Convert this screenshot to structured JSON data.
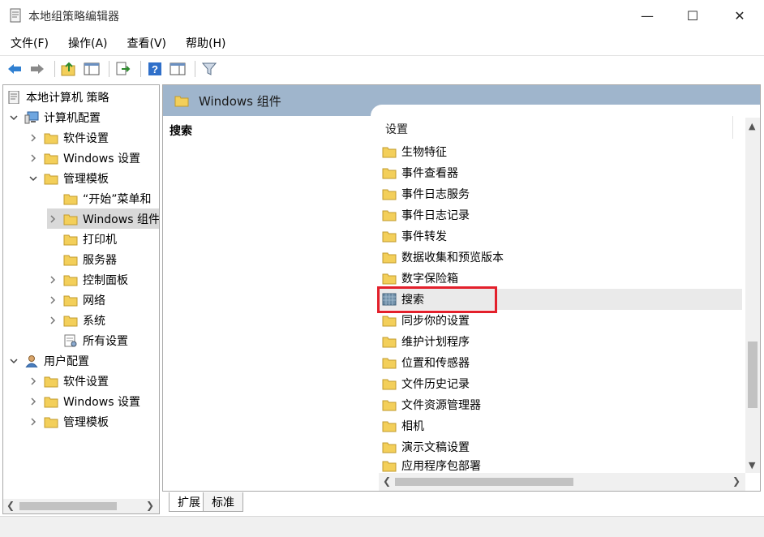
{
  "window": {
    "title": "本地组策略编辑器",
    "controls": {
      "minimize": "—",
      "maximize": "☐",
      "close": "✕"
    }
  },
  "menu": [
    {
      "label": "文件(F)"
    },
    {
      "label": "操作(A)"
    },
    {
      "label": "查看(V)"
    },
    {
      "label": "帮助(H)"
    }
  ],
  "toolbar": [
    {
      "icon": "back-arrow-icon"
    },
    {
      "icon": "forward-arrow-icon"
    },
    {
      "icon": "up-folder-icon"
    },
    {
      "icon": "show-hide-tree-icon"
    },
    {
      "icon": "export-list-icon"
    },
    {
      "icon": "help-icon"
    },
    {
      "icon": "properties-pane-icon"
    },
    {
      "icon": "filter-icon"
    }
  ],
  "tree": {
    "root": "本地计算机 策略",
    "computer_config": "计算机配置",
    "cc_software": "软件设置",
    "cc_windows": "Windows 设置",
    "cc_admin": "管理模板",
    "start_menu": "“开始”菜单和",
    "windows_components": "Windows 组件",
    "printers": "打印机",
    "server": "服务器",
    "control_panel": "控制面板",
    "network": "网络",
    "system": "系统",
    "all_settings": "所有设置",
    "user_config": "用户配置",
    "uc_software": "软件设置",
    "uc_windows": "Windows 设置",
    "uc_admin": "管理模板"
  },
  "right": {
    "header": "Windows 组件",
    "description_title": "搜索",
    "column_header": "设置",
    "items": [
      {
        "label": "生物特征"
      },
      {
        "label": "事件查看器"
      },
      {
        "label": "事件日志服务"
      },
      {
        "label": "事件日志记录"
      },
      {
        "label": "事件转发"
      },
      {
        "label": "数据收集和预览版本"
      },
      {
        "label": "数字保险箱"
      },
      {
        "label": "搜索"
      },
      {
        "label": "同步你的设置"
      },
      {
        "label": "维护计划程序"
      },
      {
        "label": "位置和传感器"
      },
      {
        "label": "文件历史记录"
      },
      {
        "label": "文件资源管理器"
      },
      {
        "label": "相机"
      },
      {
        "label": "演示文稿设置"
      },
      {
        "label": "应用程序包部署"
      }
    ]
  },
  "tabs": [
    {
      "label": "扩展"
    },
    {
      "label": "标准"
    }
  ],
  "colors": {
    "header_bg": "#9fb5cc",
    "folder_yellow": "#f3cf5a",
    "highlight_red": "#e3202b"
  }
}
